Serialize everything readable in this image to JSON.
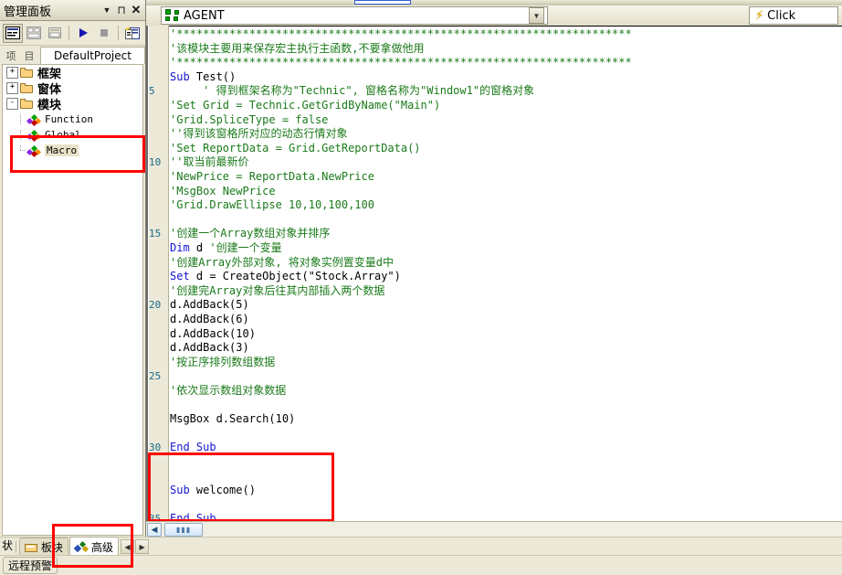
{
  "panel": {
    "title": "管理面板",
    "buttons": {
      "dropdown": "▼",
      "pin": "⊓",
      "close": "✕"
    },
    "toolbar": [
      {
        "name": "code-view-button",
        "glyph": "▤",
        "pressed": true
      },
      {
        "name": "object-view-button",
        "glyph": "▥",
        "pressed": false
      },
      {
        "name": "toggle-folders-button",
        "glyph": "▣",
        "pressed": false
      },
      {
        "name": "run-button",
        "glyph": "▶",
        "pressed": false
      },
      {
        "name": "stop-button",
        "glyph": "■",
        "pressed": false
      },
      {
        "name": "new-module-button",
        "glyph": "▤",
        "pressed": false
      }
    ],
    "project_tabs": {
      "icon_a": "项",
      "icon_b": "目",
      "project_name": "DefaultProject"
    },
    "tree": [
      {
        "label": "框架",
        "type": "folder",
        "expander": "+",
        "indent": 0
      },
      {
        "label": "窗体",
        "type": "folder",
        "expander": "+",
        "indent": 0
      },
      {
        "label": "模块",
        "type": "folder",
        "expander": "-",
        "indent": 0
      },
      {
        "label": "Function",
        "type": "module",
        "indent": 1
      },
      {
        "label": "Global",
        "type": "module",
        "indent": 1
      },
      {
        "label": "Macro",
        "type": "module",
        "indent": 1,
        "selected": true
      }
    ]
  },
  "editor": {
    "object_combo": {
      "value": "AGENT",
      "icon": "agent-module-icon",
      "arrow": "▼"
    },
    "event_combo": {
      "value": "Click",
      "icon": "lightning-bolt-icon",
      "arrow": "▼"
    },
    "lines": [
      {
        "n": 1,
        "segments": [
          {
            "t": "'*********************************************************************",
            "c": "comment"
          }
        ]
      },
      {
        "n": 2,
        "segments": [
          {
            "t": "'该模块主要用来保存宏主执行主函数,不要拿做他用",
            "c": "comment"
          }
        ]
      },
      {
        "n": 3,
        "segments": [
          {
            "t": "'*********************************************************************",
            "c": "comment"
          }
        ]
      },
      {
        "n": 4,
        "segments": [
          {
            "t": "Sub ",
            "c": "key"
          },
          {
            "t": "Test()",
            "c": "plain"
          }
        ]
      },
      {
        "n": 5,
        "segments": [
          {
            "t": "     ' 得到框架名称为\"Technic\", 窗格名称为\"Window1\"的窗格对象",
            "c": "comment"
          }
        ]
      },
      {
        "n": 6,
        "segments": [
          {
            "t": "'Set Grid = Technic.GetGridByName(\"Main\")",
            "c": "comment"
          }
        ]
      },
      {
        "n": 7,
        "segments": [
          {
            "t": "'Grid.SpliceType = false",
            "c": "comment"
          }
        ]
      },
      {
        "n": 8,
        "segments": [
          {
            "t": "''得到该窗格所对应的动态行情对象",
            "c": "comment"
          }
        ]
      },
      {
        "n": 9,
        "segments": [
          {
            "t": "'Set ReportData = Grid.GetReportData()",
            "c": "comment"
          }
        ]
      },
      {
        "n": 10,
        "segments": [
          {
            "t": "''取当前最新价",
            "c": "comment"
          }
        ]
      },
      {
        "n": 11,
        "segments": [
          {
            "t": "'NewPrice = ReportData.NewPrice",
            "c": "comment"
          }
        ]
      },
      {
        "n": 12,
        "segments": [
          {
            "t": "'MsgBox NewPrice",
            "c": "comment"
          }
        ]
      },
      {
        "n": 13,
        "segments": [
          {
            "t": "'Grid.DrawEllipse 10,10,100,100",
            "c": "comment"
          }
        ]
      },
      {
        "n": 14,
        "segments": []
      },
      {
        "n": 15,
        "segments": [
          {
            "t": "'创建一个Array数组对象并排序",
            "c": "comment"
          }
        ]
      },
      {
        "n": 16,
        "segments": [
          {
            "t": "Dim ",
            "c": "key"
          },
          {
            "t": "d ",
            "c": "plain"
          },
          {
            "t": "'创建一个变量",
            "c": "comment"
          }
        ]
      },
      {
        "n": 17,
        "segments": [
          {
            "t": "'创建Array外部对象, 将对象实例置变量d中",
            "c": "comment"
          }
        ]
      },
      {
        "n": 18,
        "segments": [
          {
            "t": "Set ",
            "c": "key"
          },
          {
            "t": "d = CreateObject(\"Stock.Array\")",
            "c": "plain"
          }
        ]
      },
      {
        "n": 19,
        "segments": [
          {
            "t": "'创建完Array对象后往其内部插入两个数据",
            "c": "comment"
          }
        ]
      },
      {
        "n": 20,
        "segments": [
          {
            "t": "d.AddBack(5)",
            "c": "plain"
          }
        ]
      },
      {
        "n": 21,
        "segments": [
          {
            "t": "d.AddBack(6)",
            "c": "plain"
          }
        ]
      },
      {
        "n": 22,
        "segments": [
          {
            "t": "d.AddBack(10)",
            "c": "plain"
          }
        ]
      },
      {
        "n": 23,
        "segments": [
          {
            "t": "d.AddBack(3)",
            "c": "plain"
          }
        ]
      },
      {
        "n": 24,
        "segments": [
          {
            "t": "'按正序排列数组数据",
            "c": "comment"
          }
        ]
      },
      {
        "n": 25,
        "segments": []
      },
      {
        "n": 26,
        "segments": [
          {
            "t": "'依次显示数组对象数据",
            "c": "comment"
          }
        ]
      },
      {
        "n": 27,
        "segments": []
      },
      {
        "n": 28,
        "segments": [
          {
            "t": "MsgBox d.Search(10)",
            "c": "plain"
          }
        ]
      },
      {
        "n": 29,
        "segments": []
      },
      {
        "n": 30,
        "segments": [
          {
            "t": "End Sub",
            "c": "key"
          }
        ]
      },
      {
        "n": 31,
        "segments": []
      },
      {
        "n": 32,
        "segments": []
      },
      {
        "n": 33,
        "segments": [
          {
            "t": "Sub ",
            "c": "key"
          },
          {
            "t": "welcome()",
            "c": "plain"
          }
        ]
      },
      {
        "n": 34,
        "segments": []
      },
      {
        "n": 35,
        "segments": [
          {
            "t": "End Sub",
            "c": "key"
          }
        ]
      }
    ],
    "visible_line_numbers": [
      5,
      10,
      15,
      20,
      25,
      30,
      35
    ],
    "hscrollbar": {
      "left_arrow": "◀",
      "thumb_glyph": "▮▮▮"
    }
  },
  "bottom": {
    "status_text": "状",
    "tabs": [
      {
        "label": "板块",
        "icon": "block-folder-icon",
        "active": false
      },
      {
        "label": "高级",
        "icon": "advanced-icon",
        "active": true
      }
    ],
    "nav": {
      "prev": "◀",
      "next": "▶"
    },
    "alert_button": "远程预警"
  },
  "colors": {
    "comment": "#1a7a1a",
    "keyword": "#1515d0",
    "linenumber": "#1a6a8a",
    "annotation_red": "#ff0000",
    "panel_bg": "#ece9d8"
  }
}
